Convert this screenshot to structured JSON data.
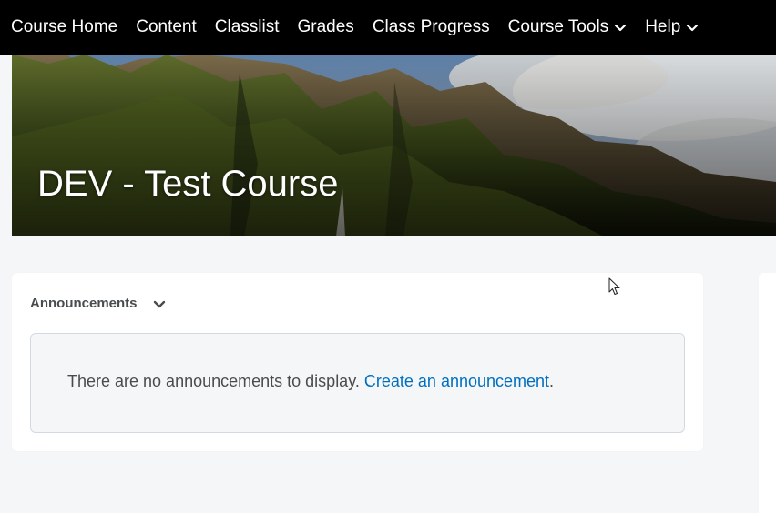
{
  "nav": {
    "items": [
      {
        "label": "Course Home",
        "dropdown": false
      },
      {
        "label": "Content",
        "dropdown": false
      },
      {
        "label": "Classlist",
        "dropdown": false
      },
      {
        "label": "Grades",
        "dropdown": false
      },
      {
        "label": "Class Progress",
        "dropdown": false
      },
      {
        "label": "Course Tools",
        "dropdown": true
      },
      {
        "label": "Help",
        "dropdown": true
      }
    ]
  },
  "banner": {
    "title": "DEV - Test Course"
  },
  "announcements": {
    "title": "Announcements",
    "empty_message": "There are no announcements to display.",
    "create_link": "Create an announcement",
    "trailing_period": "."
  },
  "colors": {
    "nav_bg": "#000000",
    "link": "#006fbf",
    "page_bg": "#f5f6f8"
  }
}
